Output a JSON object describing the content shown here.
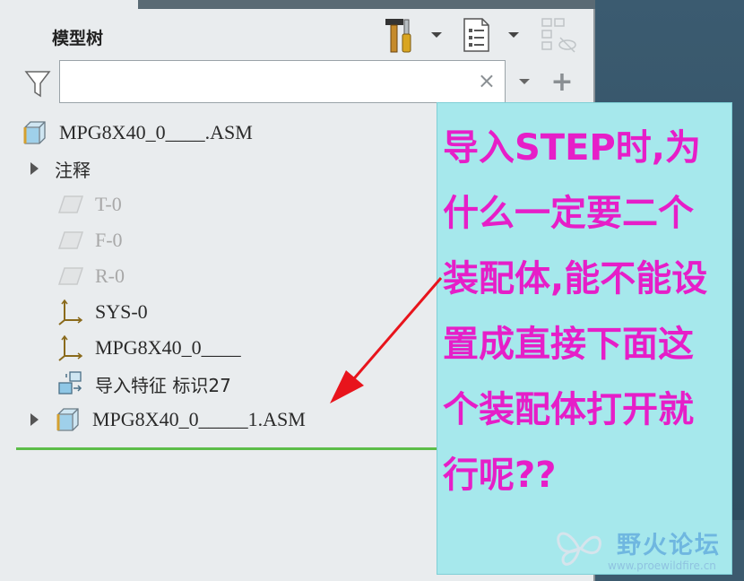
{
  "panel": {
    "title": "模型树",
    "toolbar": {
      "settings_icon": "hammer-screwdriver-icon",
      "show_icon": "list-document-icon",
      "visibility_icon": "tree-visibility-icon"
    },
    "filter": {
      "icon": "funnel-icon",
      "value": "",
      "placeholder": "",
      "clear_glyph": "×",
      "add_glyph": "+"
    }
  },
  "tree": [
    {
      "label": "MPG8X40_0____.ASM",
      "icon": "assembly-icon",
      "indent": 0,
      "expander": false,
      "dim": false
    },
    {
      "label": "注释",
      "icon": "",
      "indent": 1,
      "expander": true,
      "dim": false
    },
    {
      "label": "T-0",
      "icon": "datum-plane-icon",
      "indent": 2,
      "expander": false,
      "dim": true
    },
    {
      "label": "F-0",
      "icon": "datum-plane-icon",
      "indent": 2,
      "expander": false,
      "dim": true
    },
    {
      "label": "R-0",
      "icon": "datum-plane-icon",
      "indent": 2,
      "expander": false,
      "dim": true
    },
    {
      "label": "SYS-0",
      "icon": "coordinate-system-icon",
      "indent": 2,
      "expander": false,
      "dim": false
    },
    {
      "label": "MPG8X40_0____",
      "icon": "coordinate-system-icon",
      "indent": 2,
      "expander": false,
      "dim": false
    },
    {
      "label": "导入特征 标识27",
      "icon": "import-feature-icon",
      "indent": 2,
      "expander": false,
      "dim": false
    },
    {
      "label": "MPG8X40_0_____1.ASM",
      "icon": "assembly-icon",
      "indent": 2,
      "expander": true,
      "dim": false
    }
  ],
  "annotation": {
    "text": "导入STEP时,为什么一定要二个装配体,能不能设置成直接下面这个装配体打开就行呢??",
    "color": "#e61ec8",
    "background": "#a6e8ec"
  },
  "watermark": {
    "name": "野火论坛",
    "url": "www.proewildfire.cn"
  },
  "colors": {
    "panel_bg": "#e9ecee",
    "separator": "#5cbd48",
    "arrow": "#e8141c"
  }
}
